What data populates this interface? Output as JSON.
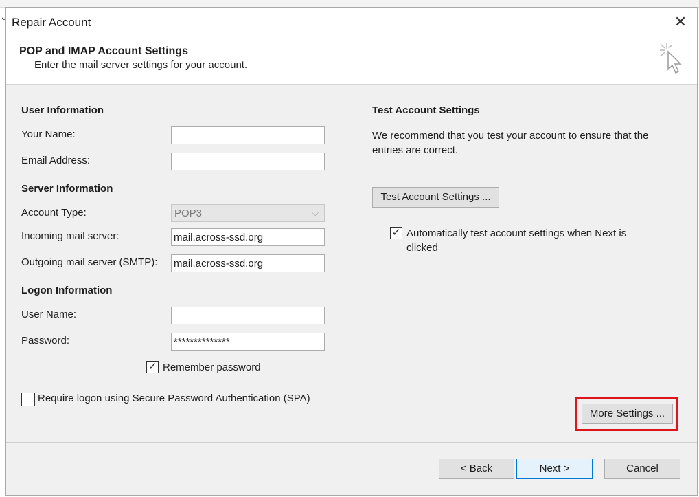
{
  "dialog": {
    "title": "Repair Account",
    "close_icon": "close-icon"
  },
  "header": {
    "title": "POP and IMAP Account Settings",
    "subtitle": "Enter the mail server settings for your account.",
    "icon": "wizard-cursor-sparkle-icon"
  },
  "user_info": {
    "heading": "User Information",
    "name_label": "Your Name:",
    "name_value": "",
    "email_label": "Email Address:",
    "email_value": ""
  },
  "server_info": {
    "heading": "Server Information",
    "account_type_label": "Account Type:",
    "account_type_value": "POP3",
    "incoming_label": "Incoming mail server:",
    "incoming_value": "mail.across-ssd.org",
    "outgoing_label": "Outgoing mail server (SMTP):",
    "outgoing_value": "mail.across-ssd.org"
  },
  "logon_info": {
    "heading": "Logon Information",
    "username_label": "User Name:",
    "username_value": "",
    "password_label": "Password:",
    "password_value": "**************",
    "remember_label": "Remember password",
    "remember_checked": true,
    "spa_label": "Require logon using Secure Password Authentication (SPA)",
    "spa_checked": false
  },
  "test_settings": {
    "heading": "Test Account Settings",
    "description": "We recommend that you test your account to ensure that the entries are correct.",
    "test_button": "Test Account Settings ...",
    "auto_test_label": "Automatically test account settings when Next is clicked",
    "auto_test_checked": true
  },
  "more_settings_button": "More Settings ...",
  "highlight_color": "#e0151c",
  "footer": {
    "back": "< Back",
    "next": "Next >",
    "cancel": "Cancel"
  }
}
